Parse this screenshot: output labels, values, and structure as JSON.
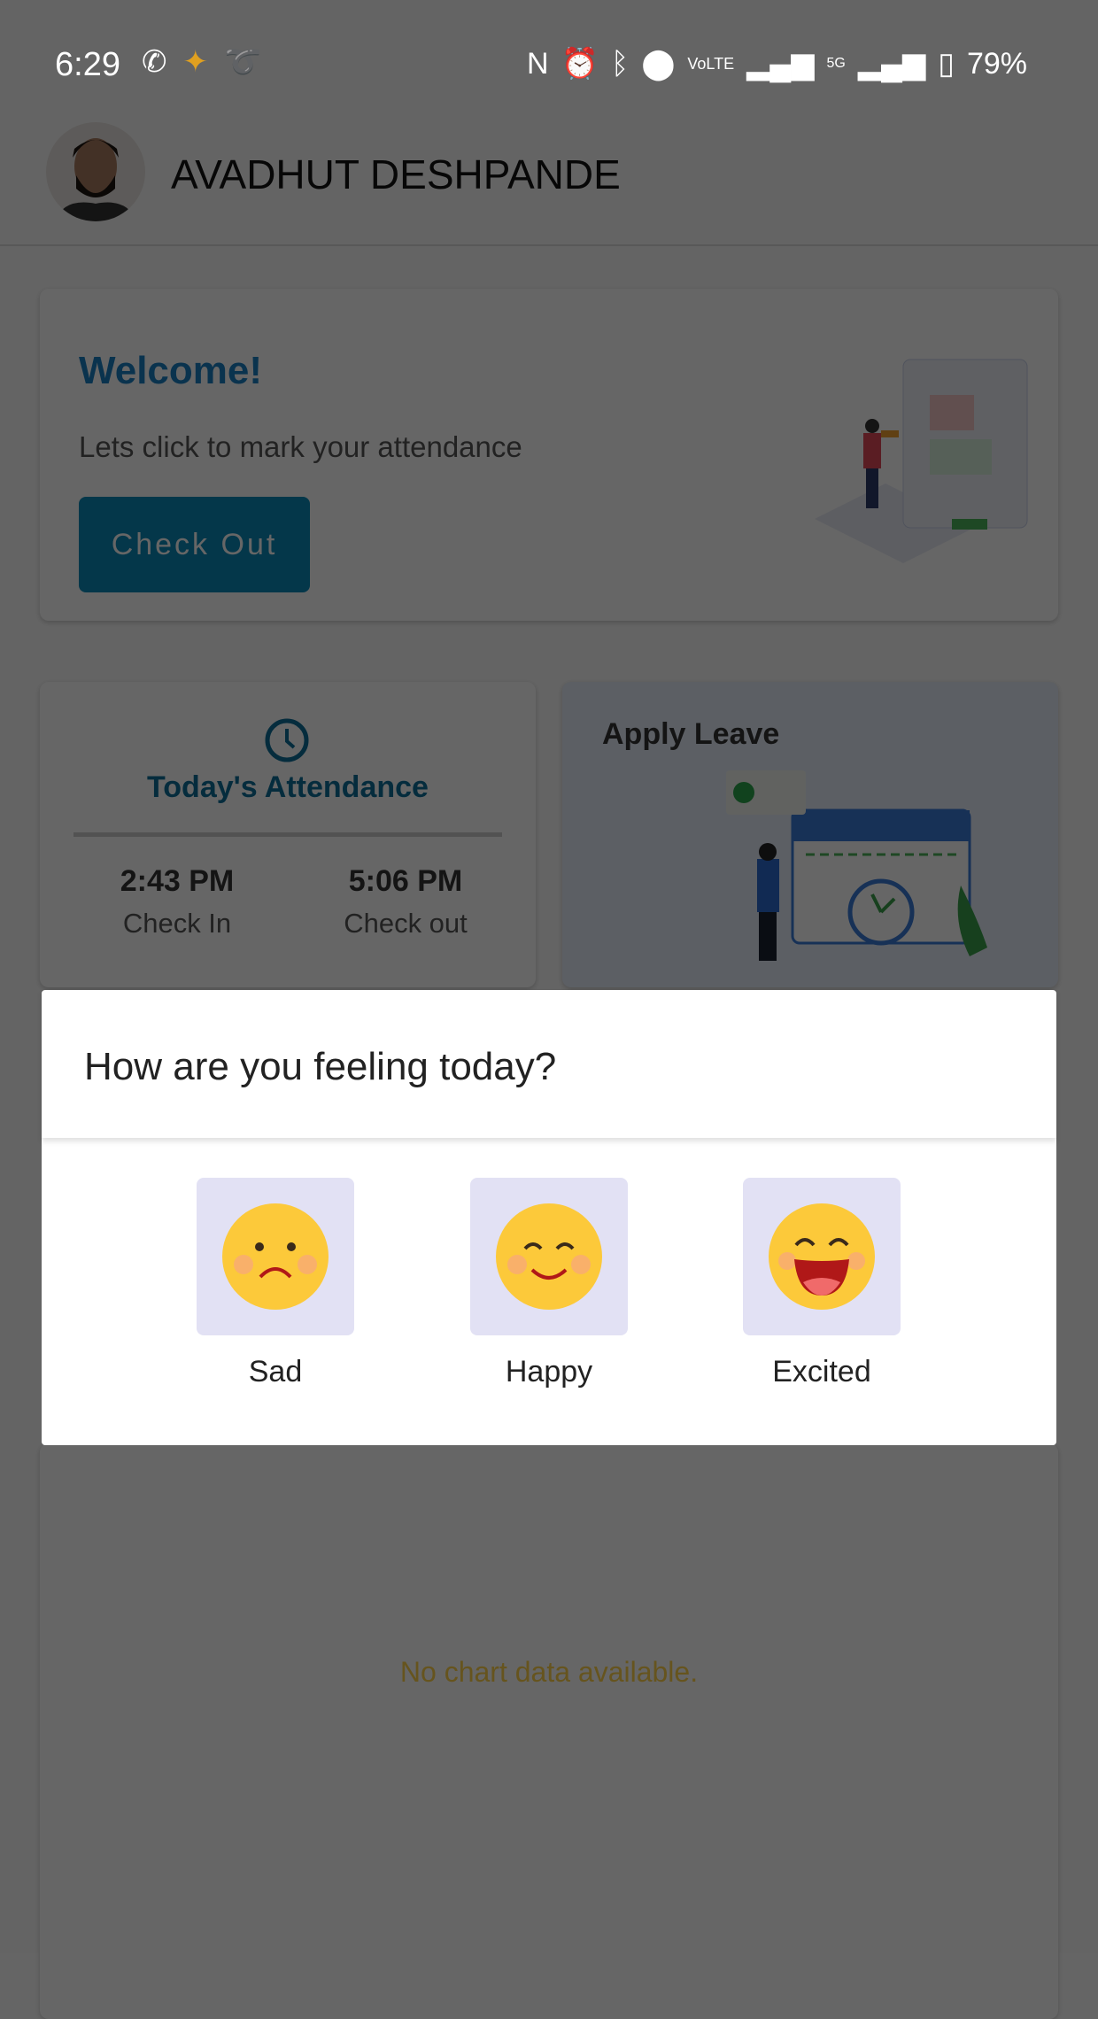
{
  "status_bar": {
    "time": "6:29",
    "battery": "79%",
    "network": "5G"
  },
  "header": {
    "user_name": "AVADHUT DESHPANDE"
  },
  "welcome": {
    "title": "Welcome!",
    "subtitle": "Lets click to mark your attendance",
    "button": "Check Out"
  },
  "attendance": {
    "title": "Today's Attendance",
    "check_in_time": "2:43 PM",
    "check_in_label": "Check In",
    "check_out_time": "5:06 PM",
    "check_out_label": "Check out"
  },
  "leave": {
    "title": "Apply Leave"
  },
  "chart": {
    "empty_message": "No chart data available."
  },
  "dialog": {
    "title": "How are you feeling today?",
    "options": [
      {
        "label": "Sad"
      },
      {
        "label": "Happy"
      },
      {
        "label": "Excited"
      }
    ]
  },
  "colors": {
    "accent": "#0a8ab8",
    "welcome_title": "#1a7fc4",
    "mood_bg": "#e2e1f4"
  }
}
